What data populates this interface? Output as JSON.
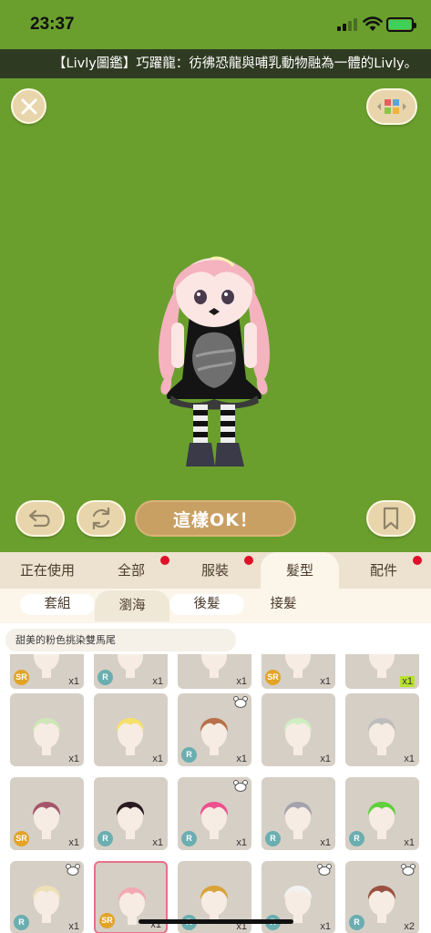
{
  "status": {
    "time": "23:37"
  },
  "ticker": {
    "text": "【Livly圖鑑】巧躍龍：彷彿恐龍與哺乳動物融為一體的Livly。"
  },
  "stage": {
    "ok_label": "這樣OK！",
    "background": "#6a9f2e"
  },
  "tabs": [
    {
      "label": "正在使用",
      "active": false,
      "dot": false
    },
    {
      "label": "全部",
      "active": false,
      "dot": true
    },
    {
      "label": "服裝",
      "active": false,
      "dot": true
    },
    {
      "label": "髮型",
      "active": true,
      "dot": false
    },
    {
      "label": "配件",
      "active": false,
      "dot": true
    }
  ],
  "subtabs": [
    {
      "label": "套組",
      "active": false
    },
    {
      "label": "瀏海",
      "active": true
    },
    {
      "label": "後髮",
      "active": false
    },
    {
      "label": "接髮",
      "active": false
    }
  ],
  "selected_item_name": "甜美的粉色挑染雙馬尾",
  "items": [
    {
      "rarity": "SR",
      "qty": "x1",
      "hair": "#e3dbd0",
      "bear": false
    },
    {
      "rarity": "R",
      "qty": "x1",
      "hair": "#e3dbd0",
      "bear": false
    },
    {
      "rarity": "",
      "qty": "x1",
      "hair": "#e3dbd0",
      "bear": false
    },
    {
      "rarity": "SR",
      "qty": "x1",
      "hair": "#e3dbd0",
      "bear": false
    },
    {
      "rarity": "",
      "qty": "x1",
      "hair": "#d9d9d9",
      "bear": false,
      "highlight": true
    },
    {
      "rarity": "",
      "qty": "x1",
      "hair": "#cfe6b8",
      "bear": false
    },
    {
      "rarity": "",
      "qty": "x1",
      "hair": "#f5e06a",
      "bear": false
    },
    {
      "rarity": "R",
      "qty": "x1",
      "hair": "#b8714a",
      "bear": true
    },
    {
      "rarity": "",
      "qty": "x1",
      "hair": "#cfeec2",
      "bear": false
    },
    {
      "rarity": "",
      "qty": "x1",
      "hair": "#bdbdbd",
      "bear": false
    },
    {
      "rarity": "SR",
      "qty": "x1",
      "hair": "#a5566a",
      "bear": false
    },
    {
      "rarity": "R",
      "qty": "x1",
      "hair": "#2a1b22",
      "bear": false
    },
    {
      "rarity": "R",
      "qty": "x1",
      "hair": "#ee4f8e",
      "bear": true
    },
    {
      "rarity": "R",
      "qty": "x1",
      "hair": "#a3a3ae",
      "bear": false
    },
    {
      "rarity": "R",
      "qty": "x1",
      "hair": "#5fcf3b",
      "bear": false
    },
    {
      "rarity": "R",
      "qty": "x1",
      "hair": "#efdfb8",
      "bear": true
    },
    {
      "rarity": "SR",
      "qty": "x1",
      "hair": "#f2a9b4",
      "bear": false,
      "selected": true
    },
    {
      "rarity": "R",
      "qty": "x1",
      "hair": "#d9a33a",
      "bear": false
    },
    {
      "rarity": "R",
      "qty": "x1",
      "hair": "#f2f2f2",
      "bear": true
    },
    {
      "rarity": "R",
      "qty": "x2",
      "hair": "#9a5042",
      "bear": true
    }
  ]
}
